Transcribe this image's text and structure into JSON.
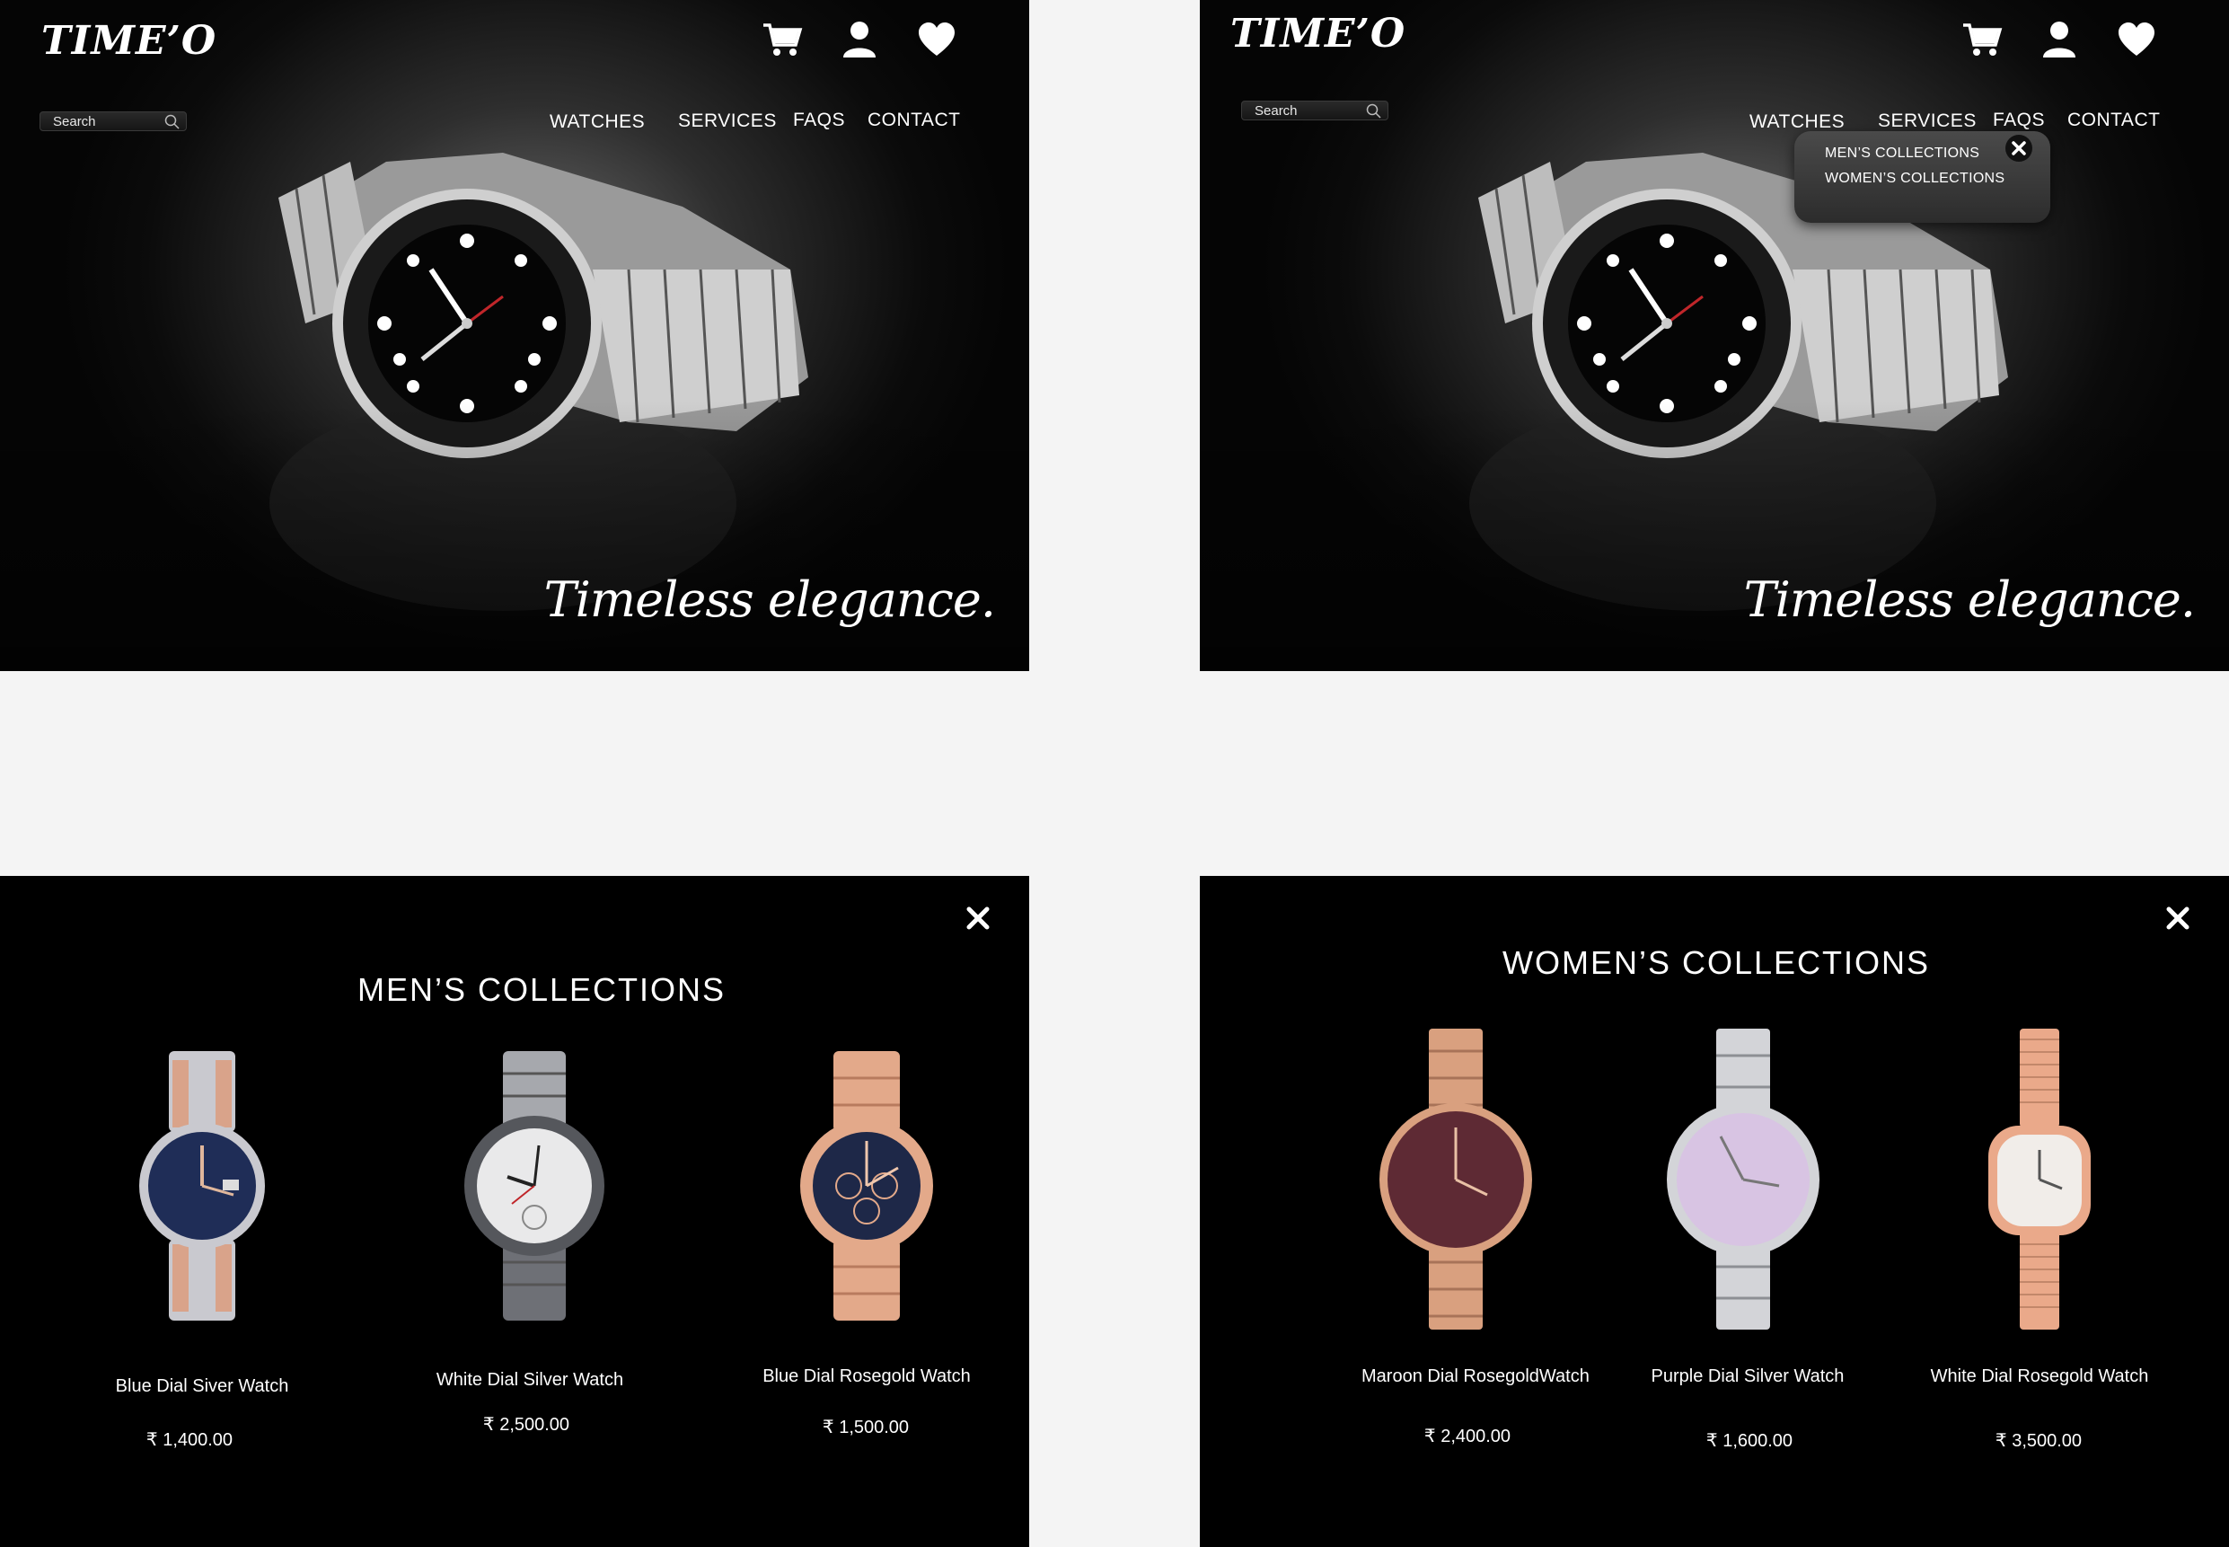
{
  "hero_default": {
    "logo": "TIME’O",
    "search_placeholder": "Search",
    "nav": [
      "WATCHES",
      "SERVICES",
      "FAQS",
      "CONTACT"
    ],
    "tagline": "Timeless elegance."
  },
  "hero_menu_open": {
    "logo": "TIME’O",
    "search_placeholder": "Search",
    "nav": [
      "WATCHES",
      "SERVICES",
      "FAQS",
      "CONTACT"
    ],
    "tagline": "Timeless elegance.",
    "dropdown": [
      "MEN’S COLLECTIONS",
      "WOMEN’S COLLECTIONS"
    ]
  },
  "mens": {
    "title": "MEN’S  COLLECTIONS",
    "products": [
      {
        "name": "Blue Dial Siver Watch",
        "price": "₹ 1,400.00",
        "dial": "#1f2d57",
        "case": "#c9c9cf",
        "strap": "mixed"
      },
      {
        "name": "White  Dial Silver Watch",
        "price": "₹ 2,500.00",
        "dial": "#e9e9ea",
        "case": "#8d8f94",
        "strap": "steel"
      },
      {
        "name": "Blue Dial Rosegold Watch",
        "price": "₹ 1,500.00",
        "dial": "#1e2848",
        "case": "#e3a98a",
        "strap": "rose"
      }
    ]
  },
  "womens": {
    "title": "WOMEN’S  COLLECTIONS",
    "products": [
      {
        "name": "Maroon Dial  RosegoldWatch",
        "price": "₹ 2,400.00",
        "dial": "#5e2a34",
        "case": "#d9a07f",
        "strap": "rose"
      },
      {
        "name": "Purple Dial Silver Watch",
        "price": "₹ 1,600.00",
        "dial": "#d8c4e3",
        "case": "#d3d4d8",
        "strap": "steel"
      },
      {
        "name": "White Dial Rosegold Watch",
        "price": "₹ 3,500.00",
        "dial": "#f1ede9",
        "case": "#eaa98a",
        "strap": "rose"
      }
    ]
  },
  "colors": {
    "background": "#f4f4f4",
    "panel": "#000000",
    "text": "#ffffff"
  },
  "icons": [
    "cart-icon",
    "user-icon",
    "heart-icon",
    "search-icon",
    "close-icon"
  ]
}
